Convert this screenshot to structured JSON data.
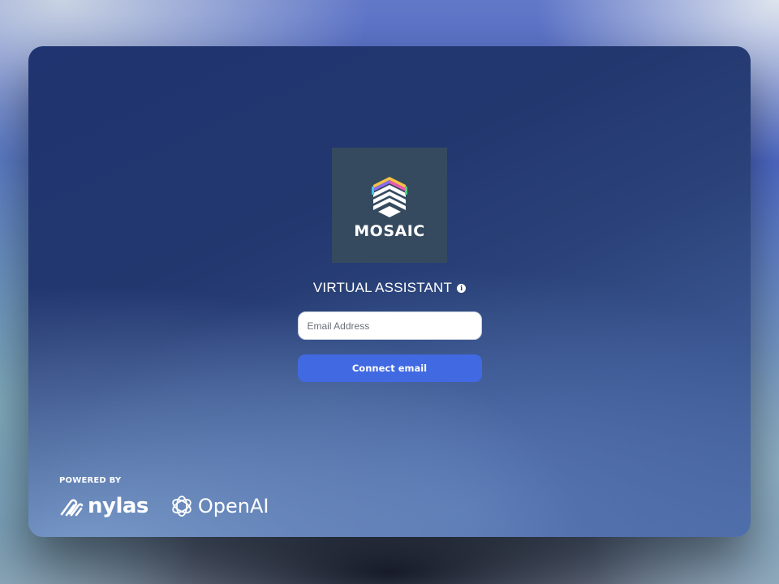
{
  "brand": {
    "logo_text": "MOSAIC",
    "logo_bg": "#364a5f",
    "stripe_colors": [
      "#f5c242",
      "#e75bb0",
      "#8c6cf2",
      "#43c6e8",
      "#52d17a"
    ]
  },
  "header": {
    "title": "VIRTUAL ASSISTANT",
    "info_icon": "info-icon"
  },
  "form": {
    "email_placeholder": "Email Address",
    "email_value": "",
    "connect_label": "Connect email",
    "button_color": "#4169e1"
  },
  "footer": {
    "powered_by_label": "POWERED BY",
    "partners": [
      {
        "name": "nylas",
        "icon": "nylas-logo-icon"
      },
      {
        "name": "OpenAI",
        "icon": "openai-logo-icon"
      }
    ]
  }
}
